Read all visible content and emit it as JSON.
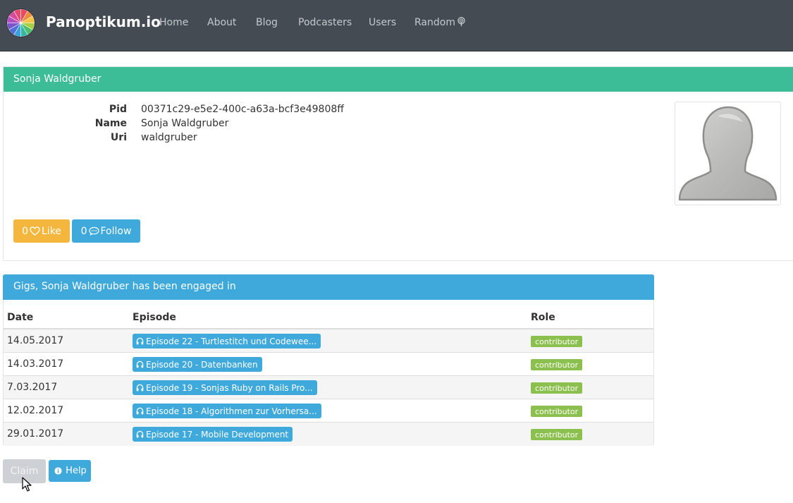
{
  "brand": {
    "name": "Panoptikum.io",
    "logo": "color-wheel-logo"
  },
  "nav": {
    "home": "Home",
    "about": "About",
    "blog": "Blog",
    "podcasters": "Podcasters",
    "users": "Users",
    "random": "Random",
    "random_icon": "podcast-icon"
  },
  "profile": {
    "title": "Sonja Waldgruber",
    "fields": [
      {
        "label": "Pid",
        "value": "00371c29-e5e2-400c-a63a-bcf3e49808ff"
      },
      {
        "label": "Name",
        "value": "Sonja Waldgruber"
      },
      {
        "label": "Uri",
        "value": "waldgruber"
      }
    ],
    "avatar": "default-user-silhouette",
    "like": {
      "count": "0",
      "label": "Like",
      "icon": "heart-icon"
    },
    "follow": {
      "count": "0",
      "label": "Follow",
      "icon": "comment-icon"
    }
  },
  "gigs": {
    "title": "Gigs, Sonja Waldgruber has been engaged in",
    "columns": {
      "date": "Date",
      "episode": "Episode",
      "role": "Role"
    },
    "rows": [
      {
        "date": "14.05.2017",
        "episode": "Episode 22 - Turtlestitch und Codewee...",
        "role": "contributor"
      },
      {
        "date": "14.03.2017",
        "episode": "Episode 20 - Datenbanken",
        "role": "contributor"
      },
      {
        "date": "7.03.2017",
        "episode": "Episode 19 - Sonjas Ruby on Rails Pro...",
        "role": "contributor"
      },
      {
        "date": "12.02.2017",
        "episode": "Episode 18 - Algorithmen zur Vorhersa...",
        "role": "contributor"
      },
      {
        "date": "29.01.2017",
        "episode": "Episode 17 - Mobile Development",
        "role": "contributor"
      }
    ]
  },
  "actions": {
    "claim": "Claim",
    "help": "Help",
    "help_icon": "info-circle-icon"
  },
  "colors": {
    "navbar": "#444b52",
    "profile_header": "#3cbd98",
    "primary": "#3ea9da",
    "warning": "#f4b63c",
    "success": "#8cc04e",
    "disabled": "#cdd0d4"
  }
}
